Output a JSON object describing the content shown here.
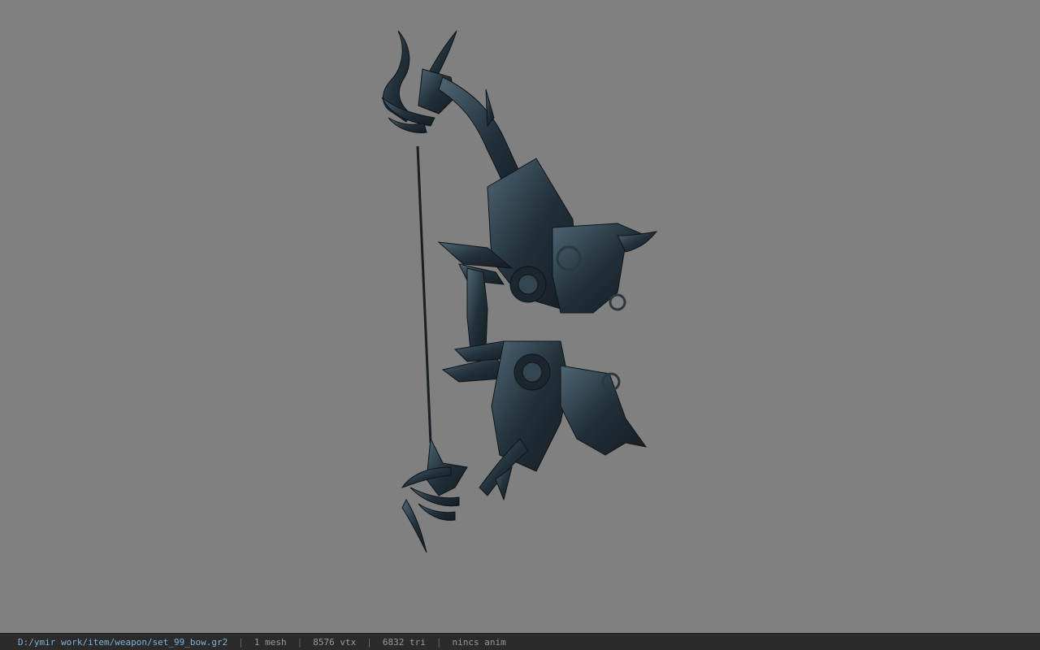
{
  "viewport": {
    "background_color": "#808080",
    "model_color": "#1e2a33",
    "model_highlight_color": "#4a6270",
    "model_name": "bow-model"
  },
  "status": {
    "file_path": "D:/ymir work/item/weapon/set_99_bow.gr2",
    "separator": "|",
    "mesh_count": "1 mesh",
    "vertex_count": "8576 vtx",
    "triangle_count": "6832 tri",
    "anim": "nincs anim"
  },
  "colors": {
    "statusbar_bg": "#2b2b2b",
    "path_text": "#7fb3d9",
    "info_text": "#9a9a9a"
  }
}
